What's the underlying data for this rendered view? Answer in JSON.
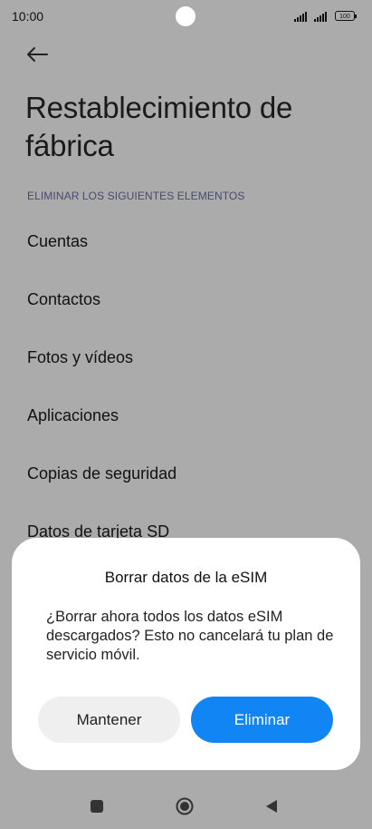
{
  "status_bar": {
    "time": "10:00",
    "battery": "100"
  },
  "header": {
    "back_icon": "arrow-left-icon",
    "title": "Restablecimiento de fábrica"
  },
  "section": {
    "header": "ELIMINAR LOS SIGUIENTES ELEMENTOS",
    "items": [
      {
        "label": "Cuentas"
      },
      {
        "label": "Contactos"
      },
      {
        "label": "Fotos y vídeos"
      },
      {
        "label": "Aplicaciones"
      },
      {
        "label": "Copias de seguridad"
      },
      {
        "label": "Datos de tarjeta SD"
      }
    ]
  },
  "dialog": {
    "title": "Borrar datos de la eSIM",
    "message": "¿Borrar ahora todos los datos eSIM descargados? Esto no cancelará tu plan de servicio móvil.",
    "keep_label": "Mantener",
    "delete_label": "Eliminar"
  },
  "colors": {
    "accent": "#1285f5",
    "scrim": "#ababab",
    "dialog_bg": "#ffffff"
  },
  "nav_bar": {
    "icons": [
      "recents-square-icon",
      "home-circle-icon",
      "back-triangle-icon"
    ]
  }
}
